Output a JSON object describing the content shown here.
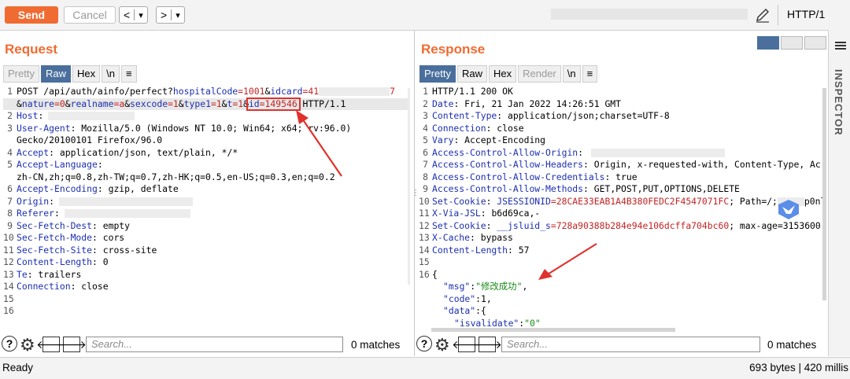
{
  "toolbar": {
    "send_label": "Send",
    "cancel_label": "Cancel",
    "back_glyph": "<",
    "back_menu_glyph": "▾",
    "forward_glyph": ">",
    "forward_menu_glyph": "▾",
    "http_version": "HTTP/1"
  },
  "request": {
    "title": "Request",
    "tabs": [
      "Pretty",
      "Raw",
      "Hex",
      "\\n",
      "≡"
    ],
    "active_tab": "Raw",
    "search_placeholder": "Search...",
    "matches": "0 matches",
    "lines": {
      "l1_method_path": "POST /api/auth/ainfo/perfect?",
      "l1_k1": "hospitalCode",
      "l1_v1": "=1001",
      "l1_amp1": "&",
      "l1_k2": "idcard",
      "l1_v2": "=41",
      "l1_tail": "7",
      "l1b_amp": "&",
      "l1b_k1": "nature",
      "l1b_v1": "=0",
      "l1b_amp2": "&",
      "l1b_k2": "realname",
      "l1b_v2": "=a",
      "l1b_amp3": "&",
      "l1b_k3": "sexcode",
      "l1b_v3": "=1",
      "l1b_amp4": "&",
      "l1b_k4": "type1",
      "l1b_v4": "=1",
      "l1b_amp5": "&",
      "l1b_k5": "t",
      "l1b_v5": "=1",
      "l1b_amp6": "&",
      "l1b_k6": "id",
      "l1b_v6": "=149546",
      "l1b_proto": " HTTP/1.1",
      "h2_k": "Host",
      "h3_k": "User-Agent",
      "h3_v": ": Mozilla/5.0 (Windows NT 10.0; Win64; x64; rv:96.0)",
      "h3_cont": "Gecko/20100101 Firefox/96.0",
      "h4_k": "Accept",
      "h4_v": ": application/json, text/plain, */*",
      "h5_k": "Accept-Language",
      "h5_cont": "zh-CN,zh;q=0.8,zh-TW;q=0.7,zh-HK;q=0.5,en-US;q=0.3,en;q=0.2",
      "h6_k": "Accept-Encoding",
      "h6_v": ": gzip, deflate",
      "h7_k": "Origin",
      "h8_k": "Referer",
      "h9_k": "Sec-Fetch-Dest",
      "h9_v": ": empty",
      "h10_k": "Sec-Fetch-Mode",
      "h10_v": ": cors",
      "h11_k": "Sec-Fetch-Site",
      "h11_v": ": cross-site",
      "h12_k": "Content-Length",
      "h12_v": ": 0",
      "h13_k": "Te",
      "h13_v": ": trailers",
      "h14_k": "Connection",
      "h14_v": ": close"
    }
  },
  "response": {
    "title": "Response",
    "tabs": [
      "Pretty",
      "Raw",
      "Hex",
      "Render",
      "\\n",
      "≡"
    ],
    "active_tab": "Pretty",
    "search_placeholder": "Search...",
    "matches": "0 matches",
    "lines": {
      "r1": "HTTP/1.1 200 OK",
      "r2_k": "Date",
      "r2_v": ": Fri, 21 Jan 2022 14:26:51 GMT",
      "r3_k": "Content-Type",
      "r3_v": ": application/json;charset=UTF-8",
      "r4_k": "Connection",
      "r4_v": ": close",
      "r5_k": "Vary",
      "r5_v": ": Accept-Encoding",
      "r6_k": "Access-Control-Allow-Origin",
      "r6_v": ":",
      "r7_k": "Access-Control-Allow-Headers",
      "r7_v": ": Origin, x-requested-with, Content-Type, Ac",
      "r8_k": "Access-Control-Allow-Credentials",
      "r8_v": ": true",
      "r9_k": "Access-Control-Allow-Methods",
      "r9_v": ": GET,POST,PUT,OPTIONS,DELETE",
      "r10_k": "Set-Cookie",
      "r10_pre": ": ",
      "r10_ck": "JSESSIONID",
      "r10_cv": "=28CAE33EAB1A4B380FEDC2F4547071FC",
      "r10_rest": "; Path=/;",
      "r10_tail": "p0nl",
      "r11_k": "X-Via-JSL",
      "r11_v": ": b6d69ca,-",
      "r12_k": "Set-Cookie",
      "r12_pre": ": ",
      "r12_ck": "__jsluid_s",
      "r12_cv": "=728a90388b284e94e106dcffa704bc60",
      "r12_rest": "; max-age=3153600",
      "r13_k": "X-Cache",
      "r13_v": ": bypass",
      "r14_k": "Content-Length",
      "r14_v": ": 57",
      "r16": "{",
      "r16a_k": "\"msg\"",
      "r16a_sep": ":",
      "r16a_v": "\"修改成功\"",
      "r16a_end": ",",
      "r16b_k": "\"code\"",
      "r16b_sep": ":1,",
      "r16c_k": "\"data\"",
      "r16c_sep": ":{",
      "r16d_k": "\"isvalidate\"",
      "r16d_sep": ":",
      "r16d_v": "\"0\""
    }
  },
  "sidebar": {
    "inspector_label": "INSPECTOR"
  },
  "status": {
    "left": "Ready",
    "right": "693 bytes | 420 millis"
  },
  "colors": {
    "accent": "#f06b32",
    "key": "#1c2fb0",
    "value": "#c42323",
    "tab_active": "#4a6f9c",
    "annotation": "#e1312c"
  },
  "icons": [
    "help-icon",
    "settings-gear-icon",
    "arrow-left-icon",
    "arrow-right-icon",
    "pencil-icon",
    "layout-icon",
    "menu-icon"
  ]
}
